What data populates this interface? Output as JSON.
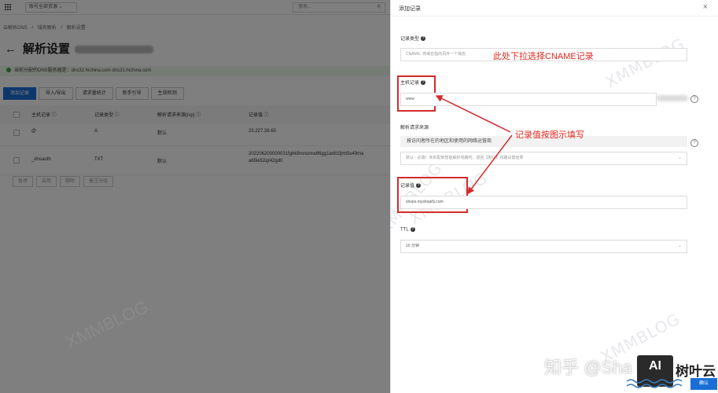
{
  "background": {
    "topbar": {
      "resource_select": "账号全部资源",
      "search_placeholder": "搜索..."
    },
    "breadcrumb": [
      "云解析DNS",
      "/",
      "域名解析",
      "/",
      "解析设置"
    ],
    "page_title": "解析设置",
    "ns_notice": "当前分配的DNS服务器是：dns32.hichina.com  dns31.hichina.com",
    "buttons": [
      "添加记录",
      "导入/导出",
      "请求量统计",
      "新手引导",
      "生效检测"
    ],
    "table": {
      "headers": [
        "主机记录 ⓘ",
        "记录类型 ⓘ",
        "解析请求来源(isp) ⓘ",
        "记录值 ⓘ"
      ],
      "rows": [
        {
          "host": "@",
          "type": "A",
          "source": "默认",
          "value": "23.227.38.65"
        },
        {
          "host": "_dnsauth",
          "type": "TXT",
          "source": "默认",
          "value": "202206200000031fghk8mnomw86gg1ie6t1fjmt5x49ma a65le52qr42gd0"
        }
      ]
    },
    "batch_buttons": [
      "暂停",
      "启用",
      "删除",
      "备注分组"
    ]
  },
  "panel": {
    "title": "添加记录",
    "close": "×",
    "record_type": {
      "label": "记录类型",
      "placeholder": "CNAME- 将域名指向另外一个域名"
    },
    "host_record": {
      "label": "主机记录",
      "value": "www"
    },
    "line": {
      "label": "解析请求来源",
      "description": "按访问者所在的地区和使用的网络运营商",
      "placeholder": "默认 - 必填！未匹配到智能解析线路时，返回【默认】线路设置结果"
    },
    "record_value": {
      "label": "记录值",
      "value": "shops.myshopify.com"
    },
    "ttl": {
      "label": "TTL",
      "value": "10 分钟"
    },
    "ok_button": "确认"
  },
  "annotations": {
    "type_note": "此处下拉选择CNAME记录",
    "value_note": "记录值按图示填写"
  },
  "watermarks": {
    "main": "XMMBLOG",
    "zhihu": "知乎 @Sha",
    "logo": "树叶云",
    "logo_box": "AI"
  },
  "colors": {
    "primary": "#1a6fd6",
    "annotation_red": "#d32b2b"
  }
}
